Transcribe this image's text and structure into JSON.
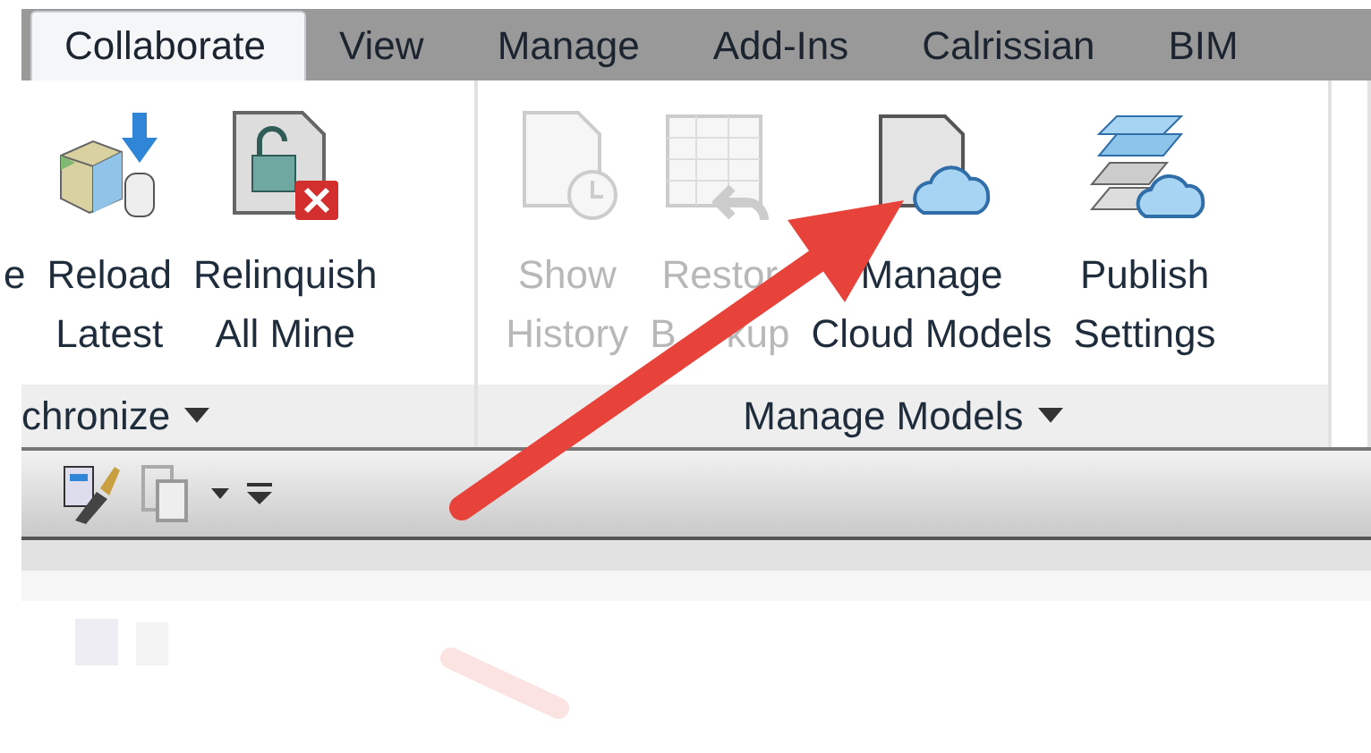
{
  "tabs": [
    {
      "label": "Collaborate",
      "selected": true
    },
    {
      "label": "View",
      "selected": false
    },
    {
      "label": "Manage",
      "selected": false
    },
    {
      "label": "Add-Ins",
      "selected": false
    },
    {
      "label": "Calrissian",
      "selected": false
    },
    {
      "label": "BIM",
      "selected": false
    }
  ],
  "panels": [
    {
      "title": "chronize",
      "buttons": [
        {
          "kind": "cut",
          "lines": [
            [
              "e"
            ]
          ],
          "disabled": false
        },
        {
          "kind": "reload",
          "lines": [
            [
              "Reload"
            ],
            [
              "Latest"
            ]
          ],
          "disabled": false
        },
        {
          "kind": "relinquish",
          "lines": [
            [
              "Relinquish"
            ],
            [
              "All Mine"
            ]
          ],
          "disabled": false
        }
      ]
    },
    {
      "title": "Manage Models",
      "buttons": [
        {
          "kind": "history",
          "lines": [
            [
              "Show"
            ],
            [
              "History"
            ]
          ],
          "disabled": true
        },
        {
          "kind": "restore",
          "lines": [
            [
              "Restor"
            ],
            [
              "B",
              "kup"
            ]
          ],
          "disabled": true
        },
        {
          "kind": "cloud",
          "lines": [
            [
              "Manage"
            ],
            [
              "Cloud Models"
            ]
          ],
          "disabled": false
        },
        {
          "kind": "publish",
          "lines": [
            [
              "Publish"
            ],
            [
              "Settings"
            ]
          ],
          "disabled": false
        }
      ]
    }
  ]
}
